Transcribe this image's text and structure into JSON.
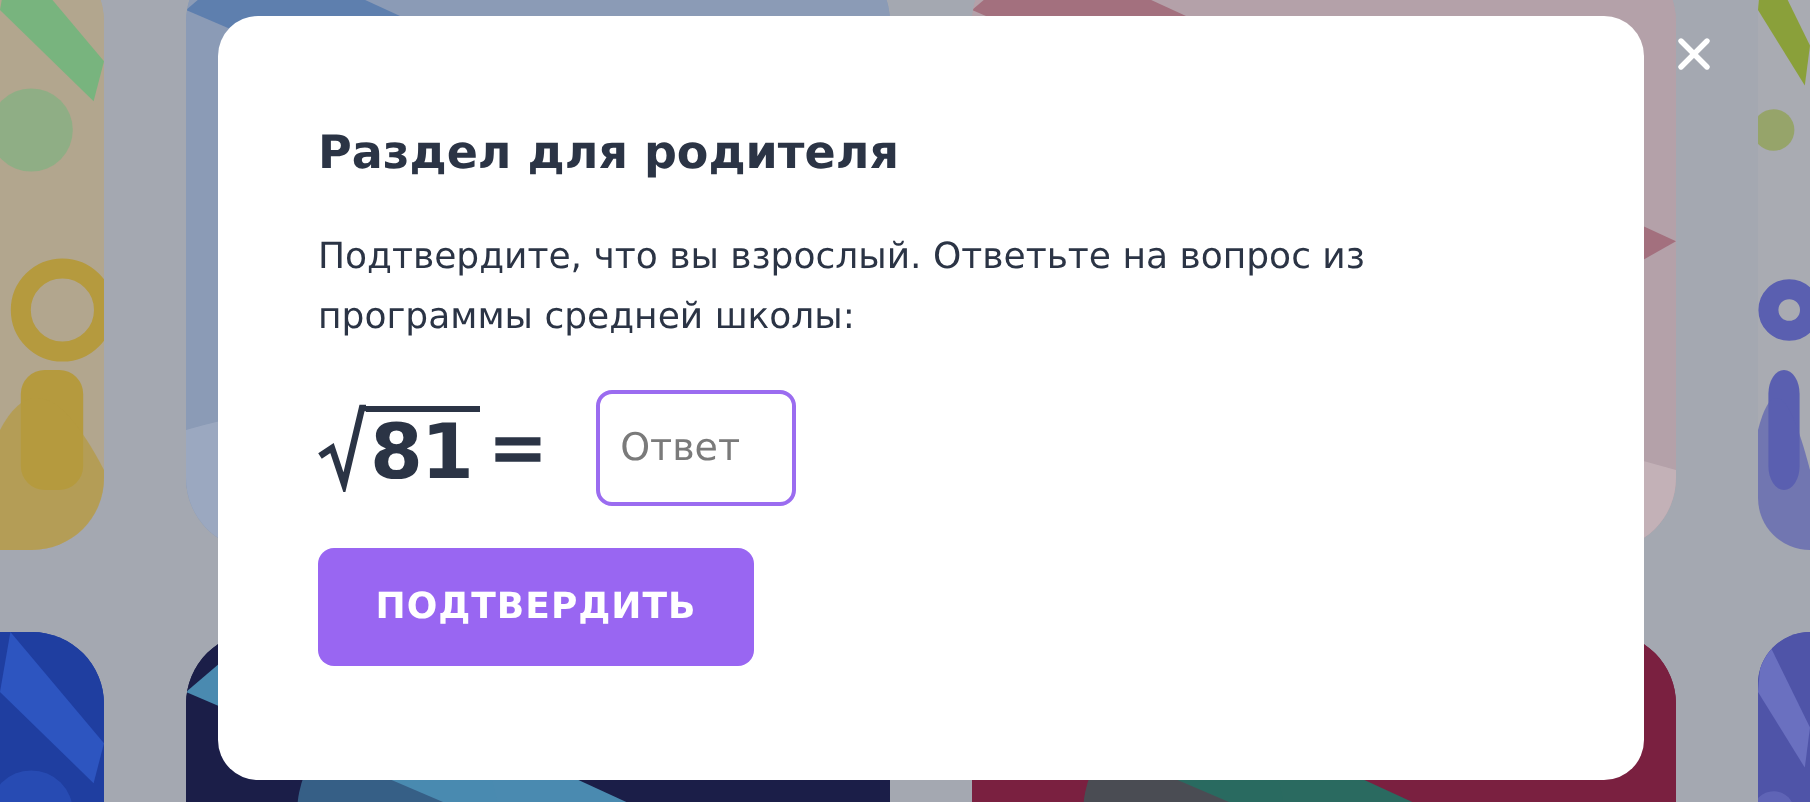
{
  "dialog": {
    "title": "Раздел для родителя",
    "prompt": "Подтвердите, что вы взрослый. Ответьте на вопрос из программы средней школы:",
    "equation": {
      "radicand": "81",
      "operator": "="
    },
    "answer": {
      "placeholder": "Ответ"
    },
    "confirm_button": "ПОДТВЕРДИТЬ"
  }
}
